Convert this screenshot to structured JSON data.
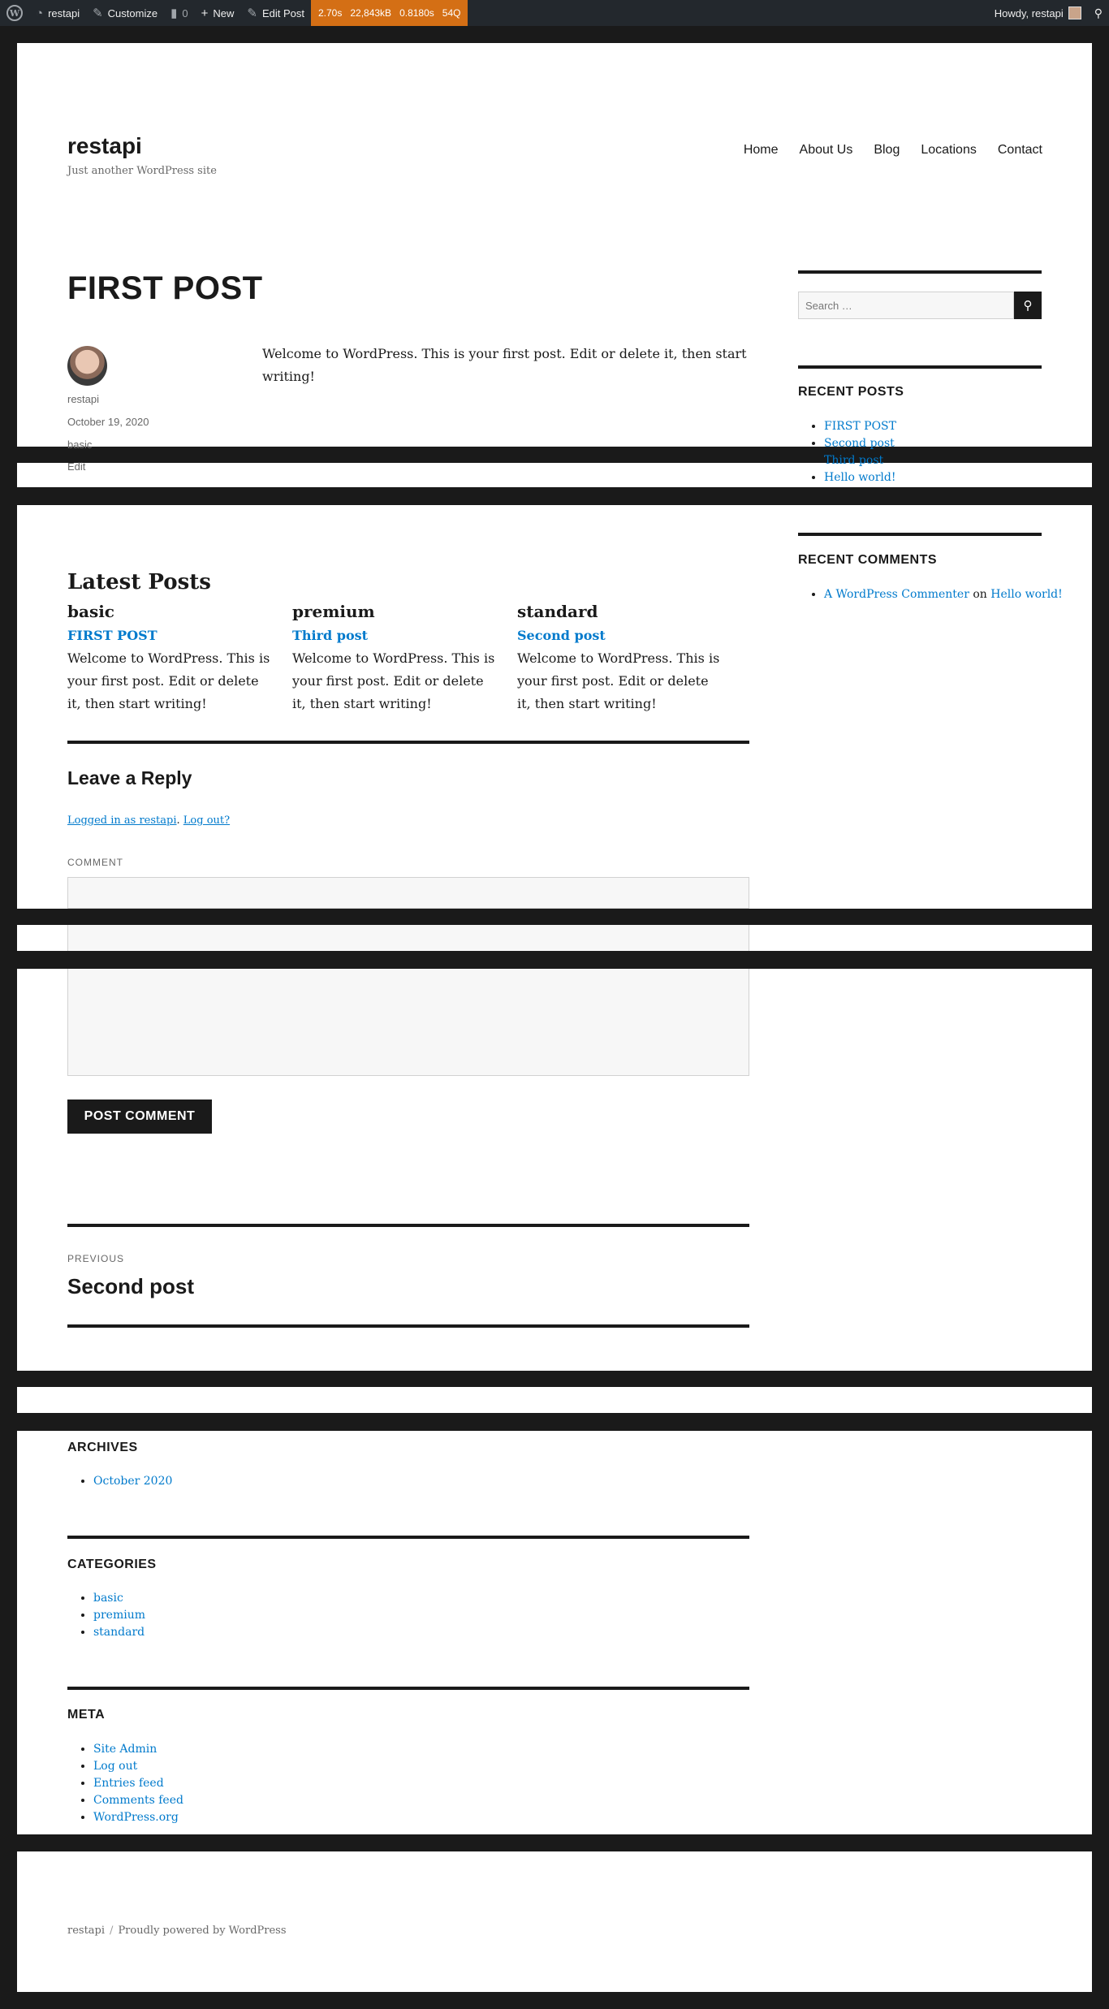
{
  "admin_bar": {
    "site": "restapi",
    "customize": "Customize",
    "comments_count": "0",
    "new": "New",
    "edit_post": "Edit Post",
    "qm": [
      "2.70s",
      "22,843kB",
      "0.8180s",
      "54Q"
    ],
    "howdy": "Howdy, restapi"
  },
  "header": {
    "title": "restapi",
    "description": "Just another WordPress site",
    "nav": [
      "Home",
      "About Us",
      "Blog",
      "Locations",
      "Contact"
    ]
  },
  "post": {
    "title": "FIRST POST",
    "author": "restapi",
    "date": "October 19, 2020",
    "category": "basic",
    "edit": "Edit",
    "content": "Welcome to WordPress. This is your first post. Edit or delete it, then start writing!"
  },
  "sidebar": {
    "search_placeholder": "Search …",
    "recent_posts_title": "RECENT POSTS",
    "recent_posts": [
      "FIRST POST",
      "Second post",
      "Third post",
      "Hello world!"
    ],
    "recent_comments_title": "RECENT COMMENTS",
    "comment_author": "A WordPress Commenter",
    "comment_on": "on",
    "comment_post": "Hello world!"
  },
  "latest_posts": {
    "title": "Latest Posts",
    "columns": [
      {
        "category": "basic",
        "post": "FIRST POST",
        "excerpt": "Welcome to WordPress. This is your first post. Edit or delete it, then start writing!"
      },
      {
        "category": "premium",
        "post": "Third post",
        "excerpt": "Welcome to WordPress. This is your first post. Edit or delete it, then start writing!"
      },
      {
        "category": "standard",
        "post": "Second post",
        "excerpt": "Welcome to WordPress. This is your first post. Edit or delete it, then start writing!"
      }
    ]
  },
  "reply": {
    "title": "Leave a Reply",
    "logged_in": "Logged in as restapi",
    "log_out": "Log out?",
    "comment_label": "COMMENT",
    "submit": "POST COMMENT"
  },
  "post_nav": {
    "label": "PREVIOUS",
    "title": "Second post"
  },
  "widgets": {
    "archives_title": "ARCHIVES",
    "archives": [
      "October 2020"
    ],
    "categories_title": "CATEGORIES",
    "categories": [
      "basic",
      "premium",
      "standard"
    ],
    "meta_title": "META",
    "meta": [
      "Site Admin",
      "Log out",
      "Entries feed",
      "Comments feed",
      "WordPress.org"
    ]
  },
  "footer": {
    "site": "restapi",
    "separator": "/",
    "powered": "Proudly powered by WordPress"
  },
  "colors": {
    "accent": "#007acc",
    "dark": "#1a1a1a",
    "query_monitor": "#d46f15",
    "admin_bar": "#23282d"
  }
}
